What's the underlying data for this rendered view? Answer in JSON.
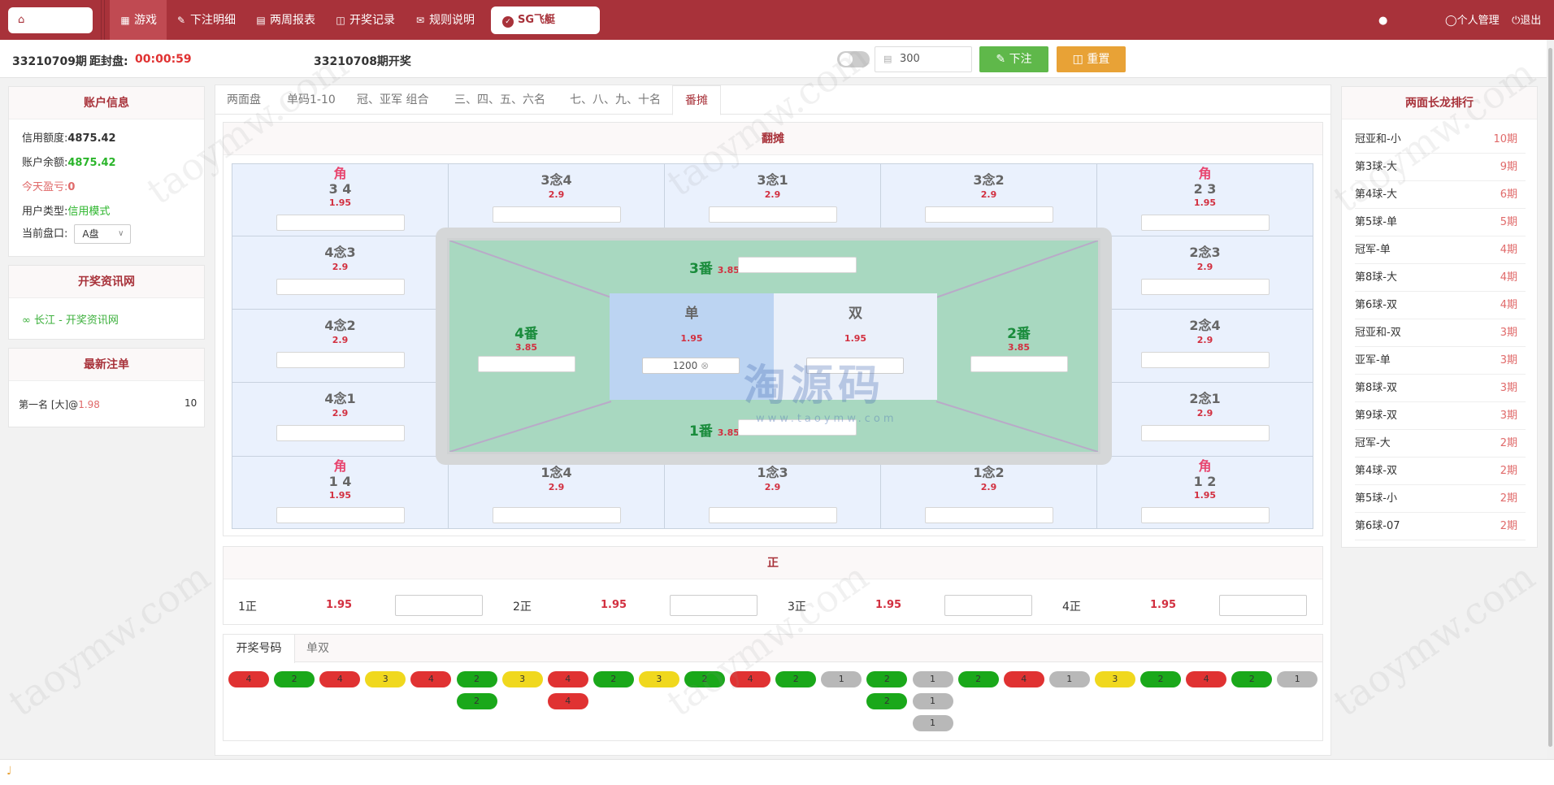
{
  "nav": {
    "home_icon": "home-icon",
    "items": [
      {
        "label": "游戏",
        "icon": "grid-icon"
      },
      {
        "label": "下注明细",
        "icon": "pencil-icon"
      },
      {
        "label": "两周报表",
        "icon": "calendar-icon"
      },
      {
        "label": "开奖记录",
        "icon": "monitor-icon"
      },
      {
        "label": "规则说明",
        "icon": "chat-icon"
      }
    ],
    "game_button": "SG飞艇",
    "user_icon": "user-icon",
    "personal": "个人管理",
    "logout": "退出",
    "accent": "#a8323a"
  },
  "info": {
    "period": "33210709期",
    "close_label": "距封盘:",
    "countdown": "00:00:59",
    "last_draw": "33210708期开奖",
    "amount": "300",
    "bet_button": "下注",
    "reset_button": "重置"
  },
  "account": {
    "title": "账户信息",
    "credit_label": "信用额度:",
    "credit_value": "4875.42",
    "balance_label": "账户余额:",
    "balance_value": "4875.42",
    "profit_label": "今天盈亏:",
    "profit_value": "0",
    "type_label": "用户类型:",
    "type_value": "信用模式",
    "plate_label": "当前盘口:",
    "plate_value": "A盘"
  },
  "links": {
    "title": "开奖资讯网",
    "item": "长江 - 开奖资讯网"
  },
  "latest": {
    "title": "最新注单",
    "item_text": "第一名 [大]@",
    "item_odds": "1.98",
    "item_amount": "10"
  },
  "tabs": [
    "两面盘",
    "单码1-10",
    "冠、亚军 组合",
    "三、四、五、六名",
    "七、八、九、十名",
    "番摊"
  ],
  "fantan": {
    "title": "翻摊",
    "top": [
      {
        "label": "角",
        "sub": "3 4",
        "odds": "1.95"
      },
      {
        "label": "3念4",
        "odds": "2.9"
      },
      {
        "label": "3念1",
        "odds": "2.9"
      },
      {
        "label": "3念2",
        "odds": "2.9"
      },
      {
        "label": "角",
        "sub": "2 3",
        "odds": "1.95"
      }
    ],
    "left": [
      {
        "label": "4念3",
        "odds": "2.9"
      },
      {
        "label": "4念2",
        "odds": "2.9"
      },
      {
        "label": "4念1",
        "odds": "2.9"
      }
    ],
    "right": [
      {
        "label": "2念3",
        "odds": "2.9"
      },
      {
        "label": "2念4",
        "odds": "2.9"
      },
      {
        "label": "2念1",
        "odds": "2.9"
      }
    ],
    "bottom": [
      {
        "label": "角",
        "sub": "1 4",
        "odds": "1.95"
      },
      {
        "label": "1念4",
        "odds": "2.9"
      },
      {
        "label": "1念3",
        "odds": "2.9"
      },
      {
        "label": "1念2",
        "odds": "2.9"
      },
      {
        "label": "角",
        "sub": "1 2",
        "odds": "1.95"
      }
    ],
    "fan3": {
      "label": "3番",
      "odds": "3.85"
    },
    "fan4": {
      "label": "4番",
      "odds": "3.85"
    },
    "fan2": {
      "label": "2番",
      "odds": "3.85"
    },
    "fan1": {
      "label": "1番",
      "odds": "3.85"
    },
    "odd": {
      "label": "单",
      "odds": "1.95",
      "value": "1200"
    },
    "even": {
      "label": "双",
      "odds": "1.95"
    }
  },
  "zheng": {
    "title": "正",
    "items": [
      {
        "label": "1正",
        "odds": "1.95"
      },
      {
        "label": "2正",
        "odds": "1.95"
      },
      {
        "label": "3正",
        "odds": "1.95"
      },
      {
        "label": "4正",
        "odds": "1.95"
      }
    ]
  },
  "results": {
    "tabs": [
      "开奖号码",
      "单双"
    ],
    "columns": [
      [
        "4"
      ],
      [
        "2"
      ],
      [
        "4"
      ],
      [
        "3"
      ],
      [
        "4"
      ],
      [
        "2",
        "2"
      ],
      [
        "3"
      ],
      [
        "4",
        "4"
      ],
      [
        "2"
      ],
      [
        "3"
      ],
      [
        "2"
      ],
      [
        "4"
      ],
      [
        "2"
      ],
      [
        "1"
      ],
      [
        "2",
        "2"
      ],
      [
        "1",
        "1",
        "1"
      ],
      [
        "2"
      ],
      [
        "4"
      ],
      [
        "1"
      ],
      [
        "3"
      ],
      [
        "2"
      ],
      [
        "4"
      ],
      [
        "2"
      ],
      [
        "1"
      ]
    ]
  },
  "ranking": {
    "title": "两面长龙排行",
    "items": [
      {
        "name": "冠亚和-小",
        "value": "10期"
      },
      {
        "name": "第3球-大",
        "value": "9期"
      },
      {
        "name": "第4球-大",
        "value": "6期"
      },
      {
        "name": "第5球-单",
        "value": "5期"
      },
      {
        "name": "冠军-单",
        "value": "4期"
      },
      {
        "name": "第8球-大",
        "value": "4期"
      },
      {
        "name": "第6球-双",
        "value": "4期"
      },
      {
        "name": "冠亚和-双",
        "value": "3期"
      },
      {
        "name": "亚军-单",
        "value": "3期"
      },
      {
        "name": "第8球-双",
        "value": "3期"
      },
      {
        "name": "第9球-双",
        "value": "3期"
      },
      {
        "name": "冠军-大",
        "value": "2期"
      },
      {
        "name": "第4球-双",
        "value": "2期"
      },
      {
        "name": "第5球-小",
        "value": "2期"
      },
      {
        "name": "第6球-07",
        "value": "2期"
      }
    ]
  },
  "watermark": {
    "text": "taoymw.com",
    "logo": "淘源码",
    "logo_url": "www.taoymw.com"
  }
}
